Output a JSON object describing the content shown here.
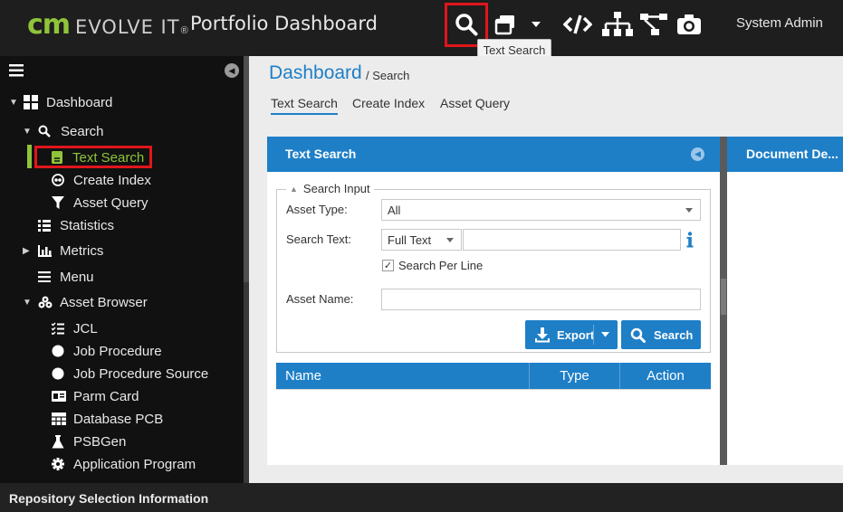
{
  "header": {
    "logo_cm": "CM",
    "logo_evolve": "EVOLVE IT",
    "logo_reg": "®",
    "title": "Portfolio Dashboard",
    "user": "System Admin",
    "icons": [
      "search-icon",
      "windows-icon",
      "caret-down-icon",
      "code-icon",
      "hierarchy-icon",
      "network-icon",
      "camera-icon"
    ],
    "tooltip": "Text Search",
    "highlight_color": "#e0161b"
  },
  "sidebar": {
    "items": [
      {
        "label": "Dashboard",
        "icon": "grid-icon"
      },
      {
        "label": "Search",
        "icon": "search-icon"
      },
      {
        "label": "Text Search",
        "icon": "document-icon"
      },
      {
        "label": "Create Index",
        "icon": "index-icon"
      },
      {
        "label": "Asset Query",
        "icon": "filter-icon"
      },
      {
        "label": "Statistics",
        "icon": "list-icon"
      },
      {
        "label": "Metrics",
        "icon": "bar-chart-icon"
      },
      {
        "label": "Menu",
        "icon": "menu-icon"
      },
      {
        "label": "Asset Browser",
        "icon": "cubes-icon"
      },
      {
        "label": "JCL",
        "icon": "checklist-icon"
      },
      {
        "label": "Job Procedure",
        "icon": "circle-icon"
      },
      {
        "label": "Job Procedure Source",
        "icon": "circle-icon"
      },
      {
        "label": "Parm Card",
        "icon": "card-icon"
      },
      {
        "label": "Database PCB",
        "icon": "database-icon"
      },
      {
        "label": "PSBGen",
        "icon": "flask-icon"
      },
      {
        "label": "Application Program",
        "icon": "gear-icon"
      }
    ],
    "accent_color": "#8fc43a"
  },
  "breadcrumb": {
    "title": "Dashboard",
    "sub": "/ Search"
  },
  "tabs": [
    {
      "label": "Text Search"
    },
    {
      "label": "Create Index"
    },
    {
      "label": "Asset Query"
    }
  ],
  "panel": {
    "title": "Text Search",
    "legend": "Search Input",
    "asset_type_label": "Asset Type:",
    "asset_type_value": "All",
    "search_text_label": "Search Text:",
    "search_mode_value": "Full Text",
    "search_text_value": "",
    "search_per_line_label": "Search Per Line",
    "asset_name_label": "Asset Name:",
    "asset_name_value": "",
    "export_label": "Export",
    "search_label": "Search",
    "columns": [
      "Name",
      "Type",
      "Action"
    ],
    "brand_color": "#1e7fc7"
  },
  "doc_panel": {
    "title": "Document De..."
  },
  "status": {
    "text": "Repository Selection Information"
  }
}
